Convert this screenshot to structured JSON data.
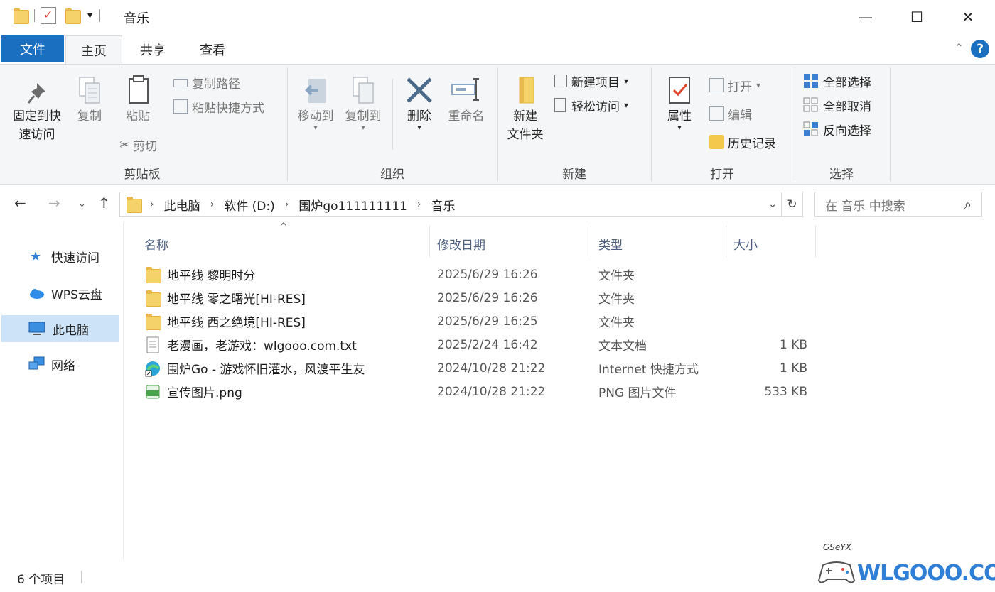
{
  "window": {
    "title": "音乐",
    "minimize": "—",
    "maximize": "☐",
    "close": "✕"
  },
  "tabs": {
    "file": "文件",
    "home": "主页",
    "share": "共享",
    "view": "查看",
    "help": "?"
  },
  "ribbon": {
    "clipboard": {
      "label": "剪贴板",
      "pin": "固定到快\n速访问",
      "pin_l1": "固定到快",
      "pin_l2": "速访问",
      "copy": "复制",
      "paste": "粘贴",
      "copy_path": "复制路径",
      "paste_shortcut": "粘贴快捷方式",
      "cut": "剪切"
    },
    "organize": {
      "label": "组织",
      "move_to": "移动到",
      "copy_to": "复制到",
      "delete": "删除",
      "rename": "重命名"
    },
    "new": {
      "label": "新建",
      "new_folder_l1": "新建",
      "new_folder_l2": "文件夹",
      "new_item": "新建项目",
      "easy_access": "轻松访问"
    },
    "open": {
      "label": "打开",
      "properties": "属性",
      "open": "打开",
      "edit": "编辑",
      "history": "历史记录"
    },
    "select": {
      "label": "选择",
      "select_all": "全部选择",
      "select_none": "全部取消",
      "invert": "反向选择"
    }
  },
  "address": {
    "crumbs": [
      "此电脑",
      "软件 (D:)",
      "围炉go111111111",
      "音乐"
    ],
    "search_placeholder": "在 音乐 中搜索"
  },
  "navpane": {
    "quick_access": "快速访问",
    "wps": "WPS云盘",
    "this_pc": "此电脑",
    "network": "网络"
  },
  "columns": {
    "name": "名称",
    "date": "修改日期",
    "type": "类型",
    "size": "大小"
  },
  "files": [
    {
      "name": "地平线 黎明时分",
      "date": "2025/6/29 16:26",
      "type": "文件夹",
      "size": "",
      "icon": "folder-icon"
    },
    {
      "name": "地平线 零之曙光[HI-RES]",
      "date": "2025/6/29 16:26",
      "type": "文件夹",
      "size": "",
      "icon": "folder-icon"
    },
    {
      "name": "地平线 西之绝境[HI-RES]",
      "date": "2025/6/29 16:25",
      "type": "文件夹",
      "size": "",
      "icon": "folder-icon"
    },
    {
      "name": "老漫画，老游戏：wlgooo.com.txt",
      "date": "2025/2/24 16:42",
      "type": "文本文档",
      "size": "1 KB",
      "icon": "text-file-icon"
    },
    {
      "name": "围炉Go - 游戏怀旧灌水，风渡平生友",
      "date": "2024/10/28 21:22",
      "type": "Internet 快捷方式",
      "size": "1 KB",
      "icon": "edge-shortcut-icon"
    },
    {
      "name": "宣传图片.png",
      "date": "2024/10/28 21:22",
      "type": "PNG 图片文件",
      "size": "533 KB",
      "icon": "png-file-icon"
    }
  ],
  "status": {
    "count": "6 个项目"
  },
  "watermark": {
    "text": "WLGOOO.COM",
    "small": "GSeYX"
  },
  "colors": {
    "accent": "#1a6fc1",
    "selection": "#cde3f7",
    "folder": "#f6d36a"
  }
}
